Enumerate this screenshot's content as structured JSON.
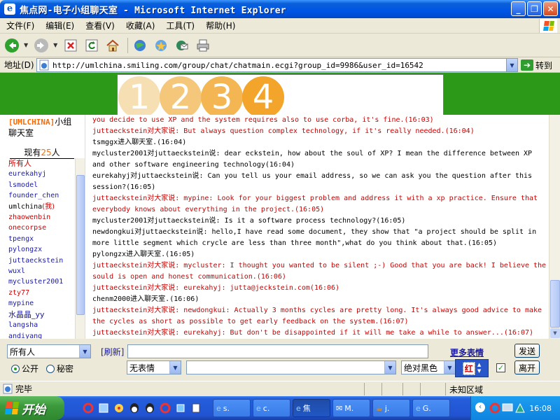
{
  "window": {
    "title": "焦点网-电子小组聊天室 - Microsoft Internet Explorer",
    "min_label": "_",
    "max_label": "❐",
    "close_label": "✕"
  },
  "menu": [
    "文件(F)",
    "编辑(E)",
    "查看(V)",
    "收藏(A)",
    "工具(T)",
    "帮助(H)"
  ],
  "address": {
    "label": "地址(D)",
    "url": "http://umlchina.smiling.com/group/chat/chatmain.ecgi?group_id=9986&user_id=16542",
    "go_label": "转到"
  },
  "banner": {
    "digits": [
      "1",
      "2",
      "3",
      "4"
    ]
  },
  "sidebar": {
    "brand": "[UMLCHINA]",
    "room_suffix": "小组聊天室",
    "online_prefix": "现有",
    "online_count": "25",
    "online_suffix": "人",
    "members": [
      {
        "name": "所有人",
        "color": "red",
        "cjk": true
      },
      {
        "name": "eurekahyj",
        "color": "blue"
      },
      {
        "name": "lsmodel",
        "color": "blue"
      },
      {
        "name": "founder_chen",
        "color": "blue"
      },
      {
        "name": "umlchina",
        "color": "black",
        "mark": "(我)"
      },
      {
        "name": "zhaowenbin",
        "color": "red"
      },
      {
        "name": "onecorpse",
        "color": "red"
      },
      {
        "name": "tpengx",
        "color": "blue"
      },
      {
        "name": "pylongzx",
        "color": "blue"
      },
      {
        "name": "juttaeckstein",
        "color": "blue"
      },
      {
        "name": "wuxl",
        "color": "blue"
      },
      {
        "name": "mycluster2001",
        "color": "blue"
      },
      {
        "name": "zty77",
        "color": "red"
      },
      {
        "name": "mypine",
        "color": "blue"
      },
      {
        "name": "水晶晶_yy",
        "color": "blue",
        "cjk": true
      },
      {
        "name": "langsha",
        "color": "blue"
      },
      {
        "name": "andiyang",
        "color": "blue"
      }
    ]
  },
  "chat": {
    "messages": [
      {
        "color": "red",
        "text": "you decide to use XP and the system requires also to use corba, it's fine.(16:03)"
      },
      {
        "color": "red",
        "text": "juttaeckstein对大家说: But always question complex technology, if it's really needed.(16:04)"
      },
      {
        "color": "black",
        "text": "tsmggx进入聊天室.(16:04)"
      },
      {
        "color": "black",
        "text": "mycluster2001对juttaeckstein说: dear eckstein, how about the soul of XP? I mean the difference between XP and other software engineering technology(16:04)"
      },
      {
        "color": "black",
        "text": "eurekahyj对juttaeckstein说: Can you tell us your email address, so we can ask you the question after this session?(16:05)"
      },
      {
        "color": "red",
        "text": "juttaeckstein对大家说: mypine: Look for your biggest problem and address it with a xp practice. Ensure that everybody knows about everything in the project.(16:05)"
      },
      {
        "color": "black",
        "text": "mycluster2001对juttaeckstein说: Is it a software process technology?(16:05)"
      },
      {
        "color": "black",
        "text": "newdongkui对juttaeckstein说: hello,I have read some document, they show that \"a project should be split in more little segment which crycle are less than three month\",what do you think about that.(16:05)"
      },
      {
        "color": "black",
        "text": "pylongzx进入聊天室.(16:05)"
      },
      {
        "color": "red",
        "text": "juttaeckstein对大家说: mycluster: I thought you wanted to be silent ;-) Good that you are back! I believe the sould is open and honest communication.(16:06)"
      },
      {
        "color": "red",
        "text": "juttaeckstein对大家说: eurekahyj: jutta@jeckstein.com(16:06)"
      },
      {
        "color": "black",
        "text": "chenm2000进入聊天室.(16:06)"
      },
      {
        "color": "red",
        "text": "juttaeckstein对大家说: newdongkui: Actually 3 months cycles are pretty long. It's always good advice to make the cycles as short as possible to get early feedback on the system.(16:07)"
      },
      {
        "color": "red",
        "text": "juttaeckstein对大家说: eurekahyj: But don't be disappointed if it will me take a while to answer...(16:07)"
      }
    ]
  },
  "controls": {
    "recipient": "所有人",
    "refresh": "[刷新]",
    "more_emotes": "更多表情",
    "send": "发送",
    "radio_public": "公开",
    "radio_private": "秘密",
    "emote": "无表情",
    "color": "绝对黑色",
    "red_label": "红",
    "leave": "离开"
  },
  "status": {
    "text": "完毕",
    "zone": "未知区域"
  },
  "taskbar": {
    "start": "开始",
    "tasks": [
      "s.",
      "c.",
      "焦",
      "M.",
      "j.",
      "G."
    ],
    "clock": "16:08"
  },
  "colors": {
    "banner_green": "#2c9a18",
    "logo_orange": "#f3a42a",
    "chat_red": "#cc0000",
    "member_blue": "#1a1aa6"
  }
}
